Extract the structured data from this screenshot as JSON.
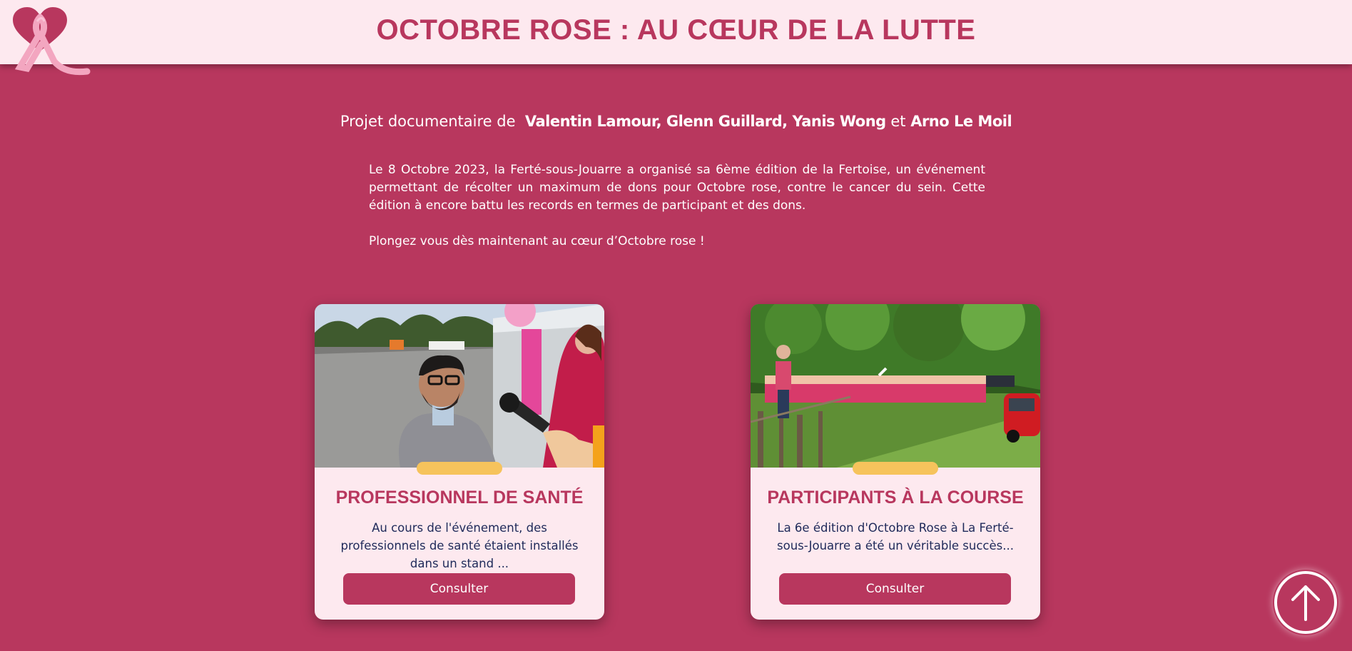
{
  "header": {
    "title": "OCTOBRE ROSE : AU CŒUR DE LA LUTTE",
    "logo_icon": "pink-ribbon-heart-logo"
  },
  "credits": {
    "prefix": "Projet documentaire de",
    "authors": [
      "Valentin Lamour",
      "Glenn Guillard",
      "Yanis Wong",
      "Arno Le Moil"
    ],
    "sep1": ", ",
    "sep2": ", ",
    "conj": " et "
  },
  "intro": {
    "paragraph": "Le 8 Octobre 2023, la Ferté-sous-Jouarre a organisé sa 6ème édition de la Fertoise, un événement permettant de récolter un maximum de dons pour Octobre rose, contre le cancer du sein. Cette édition à encore battu les records en termes de participant et des dons.",
    "cta": "Plongez vous dès maintenant au cœur d’Octobre rose !"
  },
  "cards": [
    {
      "title": "PROFESSIONNEL DE SANTÉ",
      "text": "Au cours de l'événement, des professionnels de santé étaient installés dans un stand ...",
      "button": "Consulter",
      "image": "interview-photo"
    },
    {
      "title": "PARTICIPANTS À LA COURSE",
      "text": "La 6e édition d'Octobre Rose à La Ferté-sous-Jouarre a été un véritable succès...",
      "button": "Consulter",
      "image": "race-participants-photo"
    }
  ],
  "scroll_top": {
    "icon": "arrow-up-icon"
  },
  "colors": {
    "background": "#b8375e",
    "header_bg": "#fde9ef",
    "card_bg": "#fde9ef",
    "accent": "#f6c35c",
    "card_text": "#1f2a5a"
  }
}
